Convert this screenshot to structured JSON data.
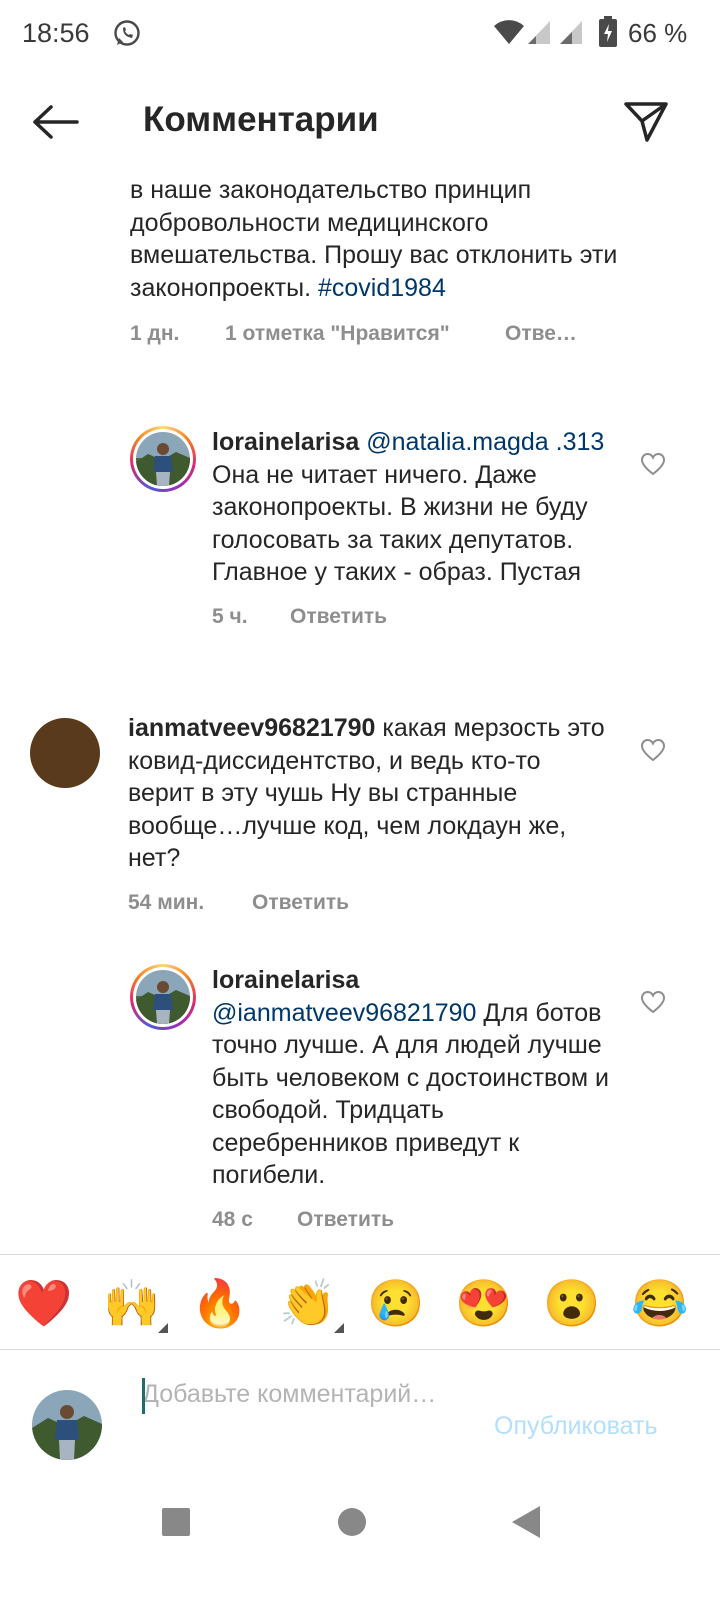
{
  "status_bar": {
    "time": "18:56",
    "battery": "66 %"
  },
  "header": {
    "title": "Комментарии"
  },
  "comments": [
    {
      "text": "в наше законодательство принцип добровольности медицинского вмешательства. Прошу вас отклонить эти законопроекты.",
      "hashtag": "#covid1984",
      "time": "1 дн.",
      "likes": "1 отметка \"Нравится\"",
      "reply": "Отве…"
    },
    {
      "username": "lorainelarisa",
      "mention": "@natalia.magda .313",
      "text": " Она не читает ничего. Даже законопроекты. В жизни не буду голосовать за таких депутатов. Главное у таких - образ. Пустая",
      "time": "5 ч.",
      "reply": "Ответить"
    },
    {
      "username": "ianmatveev96821790",
      "text": " какая мерзость это ковид-диссидентство, и ведь кто-то верит в эту чушь Ну вы странные вообще…лучше код, чем локдаун же, нет?",
      "time": "54 мин.",
      "reply": "Ответить"
    },
    {
      "username": "lorainelarisa",
      "mention": "@ianmatveev96821790",
      "text": " Для ботов точно лучше. А для людей лучше быть человеком с достоинством и свободой. Тридцать серебренников приведут к погибели.",
      "time": "48 с",
      "reply": "Ответить"
    }
  ],
  "reactions": [
    "❤️",
    "🙌",
    "🔥",
    "👏",
    "😢",
    "😍",
    "😮",
    "😂"
  ],
  "composer": {
    "placeholder": "Добавьте комментарий…",
    "publish": "Опубликовать"
  },
  "colors": {
    "link": "#00376b",
    "meta": "#8e8e8e",
    "publish": "#b2dffc",
    "text": "#262626"
  }
}
